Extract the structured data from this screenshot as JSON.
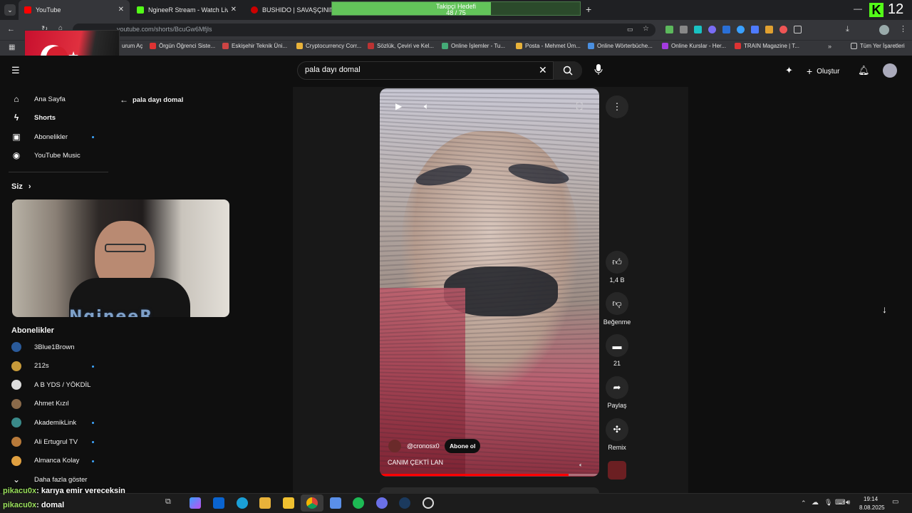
{
  "browser": {
    "tabs": [
      {
        "title": "YouTube",
        "color": "#ff0000"
      },
      {
        "title": "NgineeR Stream - Watch Live o",
        "color": "#53fc18"
      },
      {
        "title": "BUSHIDO | SAVAŞÇININ YOL",
        "color": "#cc0000"
      }
    ],
    "new_tab": "+",
    "url": "youtube.com/shorts/BcuGw6Mfjls",
    "bookmarks": [
      "urum Aç",
      "Örgün Öğrenci Siste...",
      "Eskişehir Teknik Üni...",
      "Cryptocurrency Corr...",
      "Sözlük, Çeviri ve Kel...",
      "Online İşlemler - Tu...",
      "Posta - Mehmet Üm...",
      "Online Wörterbüche...",
      "Online Kurslar - Her...",
      "TRAIN Magazine | T...",
      "Tüm Yer İşaretleri"
    ]
  },
  "overlay": {
    "follower_goal_label": "Takipçi Hedefi",
    "follower_goal_value": "48 / 75",
    "follower_goal_progress": 0.64,
    "kick_count": "12",
    "streamer_name": "NgineeR"
  },
  "youtube": {
    "search_query": "pala dayı domal",
    "create_label": "Oluştur",
    "back_label": "pala dayı domal",
    "nav": [
      "Ana Sayfa",
      "Shorts",
      "Abonelikler",
      "YouTube Music"
    ],
    "you_label": "Siz",
    "subs_heading": "Abonelikler",
    "subscriptions": [
      {
        "name": "3Blue1Brown",
        "dot": false
      },
      {
        "name": "212s",
        "dot": true
      },
      {
        "name": "A B YDS / YÖKDİL",
        "dot": false
      },
      {
        "name": "Ahmet Kızıl",
        "dot": false
      },
      {
        "name": "AkademikLink",
        "dot": true
      },
      {
        "name": "Ali Ertugrul TV",
        "dot": true
      },
      {
        "name": "Almanca Kolay",
        "dot": true
      }
    ],
    "show_more": "Daha fazla göster",
    "short": {
      "channel": "@cronosx0",
      "subscribe": "Abone ol",
      "caption": "CANIM ÇEKTİ LAN",
      "likes": "1,4 B",
      "dislike_label": "Beğenme",
      "comments": "21",
      "share_label": "Paylaş",
      "remix_label": "Remix"
    }
  },
  "chat": [
    {
      "user": "pikacu0x",
      "msg": ": karıya emir vereceksin"
    },
    {
      "user": "pikacu0x",
      "msg": ": domal"
    }
  ],
  "system": {
    "time": "19:14",
    "date": "8.08.2025"
  }
}
